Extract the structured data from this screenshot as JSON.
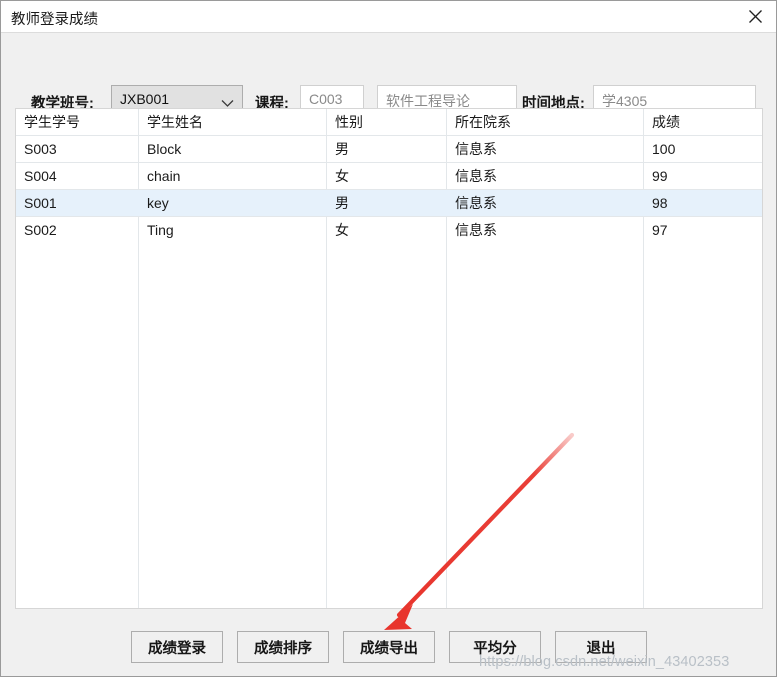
{
  "window": {
    "title": "教师登录成绩",
    "close_icon": "close-icon"
  },
  "form": {
    "class_label": "教学班号:",
    "class_value": "JXB001",
    "class_chevron_icon": "chevron-down-icon",
    "course_label": "课程:",
    "course_code_value": "C003",
    "course_name_value": "软件工程导论",
    "time_place_label": "时间地点:",
    "time_place_value": "学4305"
  },
  "table": {
    "columns": [
      "学生学号",
      "学生姓名",
      "性别",
      "所在院系",
      "成绩"
    ],
    "rows": [
      {
        "id": "S003",
        "name": "Block",
        "gender": "男",
        "dept": "信息系",
        "score": "100",
        "selected": false
      },
      {
        "id": "S004",
        "name": "chain",
        "gender": "女",
        "dept": "信息系",
        "score": "99",
        "selected": false
      },
      {
        "id": "S001",
        "name": "key",
        "gender": "男",
        "dept": "信息系",
        "score": "98",
        "selected": true
      },
      {
        "id": "S002",
        "name": "Ting",
        "gender": "女",
        "dept": "信息系",
        "score": "97",
        "selected": false
      }
    ]
  },
  "buttons": [
    {
      "label": "成绩登录"
    },
    {
      "label": "成绩排序"
    },
    {
      "label": "成绩导出"
    },
    {
      "label": "平均分"
    },
    {
      "label": "退出"
    }
  ],
  "annotation": {
    "arrow_icon": "red-arrow-icon",
    "arrow_color": "#e8352d",
    "points_at": "成绩导出"
  },
  "watermark": {
    "text": "https://blog.csdn.net/weixin_43402353"
  },
  "colors": {
    "dialog_bg": "#f0f0f0",
    "titlebar_bg": "#ffffff",
    "selection": "#e6f1fb",
    "combo_bg": "#e1e1e1",
    "border": "#adadad"
  }
}
